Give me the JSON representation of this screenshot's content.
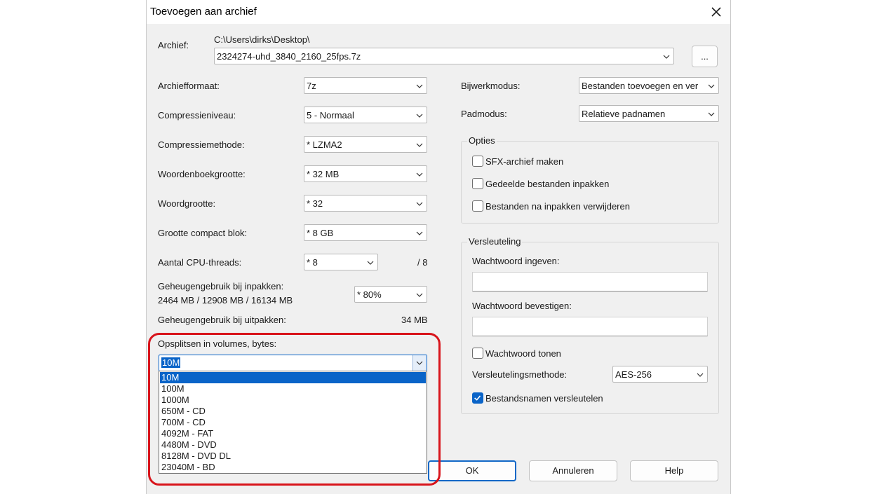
{
  "window": {
    "title": "Toevoegen aan archief"
  },
  "archive": {
    "label": "Archief:",
    "path": "C:\\Users\\dirks\\Desktop\\",
    "filename": "2324274-uhd_3840_2160_25fps.7z",
    "browse_label": "..."
  },
  "settings": {
    "format": {
      "label": "Archiefformaat:",
      "value": "7z"
    },
    "level": {
      "label": "Compressieniveau:",
      "value": "5 - Normaal"
    },
    "method": {
      "label": "Compressiemethode:",
      "value": "* LZMA2"
    },
    "dict": {
      "label": "Woordenboekgrootte:",
      "value": "* 32 MB"
    },
    "word": {
      "label": "Woordgrootte:",
      "value": "* 32"
    },
    "solid": {
      "label": "Grootte compact blok:",
      "value": "* 8 GB"
    },
    "threads": {
      "label": "Aantal CPU-threads:",
      "value": "* 8",
      "max": "/ 8"
    },
    "mem_pack": {
      "label": "Geheugengebruik bij inpakken:",
      "detail": "2464 MB / 12908 MB / 16134 MB",
      "value": "* 80%"
    },
    "mem_unpack": {
      "label": "Geheugengebruik bij uitpakken:",
      "value": "34 MB"
    },
    "split": {
      "label": "Opsplitsen in volumes, bytes:",
      "value": "10M",
      "options": [
        "10M",
        "100M",
        "1000M",
        "650M - CD",
        "700M - CD",
        "4092M - FAT",
        "4480M - DVD",
        "8128M - DVD DL",
        "23040M - BD"
      ]
    }
  },
  "right": {
    "update_mode": {
      "label": "Bijwerkmodus:",
      "value": "Bestanden toevoegen en ver"
    },
    "path_mode": {
      "label": "Padmodus:",
      "value": "Relatieve padnamen"
    },
    "options": {
      "title": "Opties",
      "sfx": "SFX-archief maken",
      "shared": "Gedeelde bestanden inpakken",
      "delete": "Bestanden na inpakken verwijderen"
    },
    "encryption": {
      "title": "Versleuteling",
      "pw_label": "Wachtwoord ingeven:",
      "pw_confirm_label": "Wachtwoord bevestigen:",
      "show_pw": "Wachtwoord tonen",
      "method_label": "Versleutelingsmethode:",
      "method_value": "AES-256",
      "encrypt_names": "Bestandsnamen versleutelen"
    }
  },
  "buttons": {
    "ok": "OK",
    "cancel": "Annuleren",
    "help": "Help"
  },
  "colors": {
    "accent": "#0a64c8",
    "highlight": "#d8141b"
  }
}
